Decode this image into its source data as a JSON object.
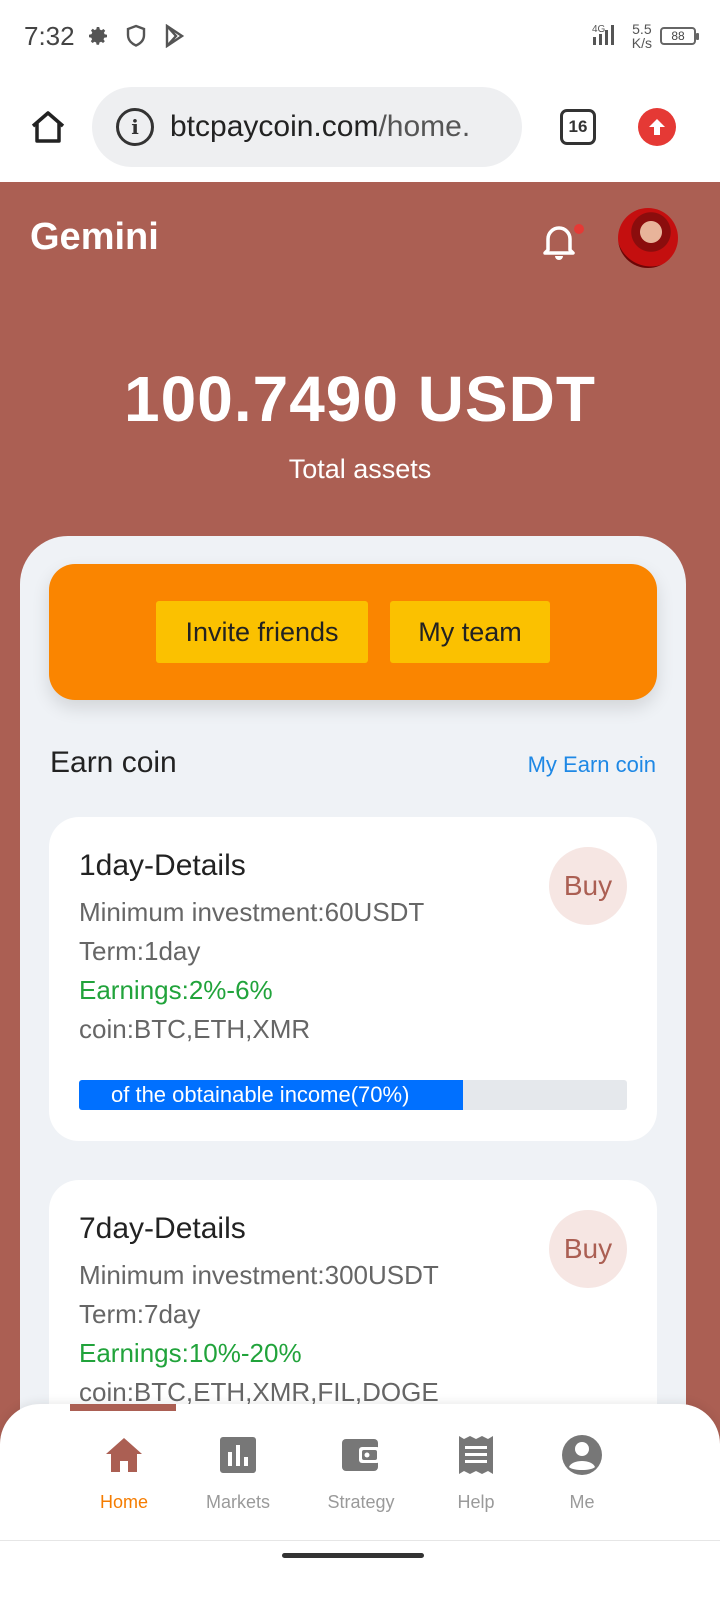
{
  "status_bar": {
    "time": "7:32",
    "net_speed_top": "5.5",
    "net_speed_bottom": "K/s",
    "battery": "88",
    "signal_label": "4G"
  },
  "browser": {
    "url_domain": "btcpaycoin.com",
    "url_path": "/home.",
    "tab_count": "16"
  },
  "header": {
    "app_title": "Gemini",
    "total_value": "100.7490 USDT",
    "total_label": "Total assets"
  },
  "actions": {
    "invite_label": "Invite friends",
    "team_label": "My team"
  },
  "earn": {
    "section_title": "Earn coin",
    "link_label": "My Earn coin"
  },
  "cards": [
    {
      "title": "1day-Details",
      "min_investment": "Minimum investment:60USDT",
      "term": "Term:1day",
      "earnings": "Earnings:2%-6%",
      "coins": "coin:BTC,ETH,XMR",
      "buy_label": "Buy",
      "progress_label": "of the obtainable income(70%)",
      "progress_percent": 70
    },
    {
      "title": "7day-Details",
      "min_investment": "Minimum investment:300USDT",
      "term": "Term:7day",
      "earnings": "Earnings:10%-20%",
      "coins": "coin:BTC,ETH,XMR,FIL,DOGE",
      "buy_label": "Buy"
    }
  ],
  "nav": [
    {
      "label": "Home",
      "icon": "home-icon",
      "active": true
    },
    {
      "label": "Markets",
      "icon": "chart-icon",
      "active": false
    },
    {
      "label": "Strategy",
      "icon": "wallet-icon",
      "active": false
    },
    {
      "label": "Help",
      "icon": "receipt-icon",
      "active": false
    },
    {
      "label": "Me",
      "icon": "user-icon",
      "active": false
    }
  ],
  "colors": {
    "brand": "#ab5f53",
    "accent_orange": "#fa8500",
    "button_yellow": "#fbc100",
    "progress_blue": "#0070ff",
    "earnings_green": "#21a33b",
    "link_blue": "#1e88e5"
  }
}
